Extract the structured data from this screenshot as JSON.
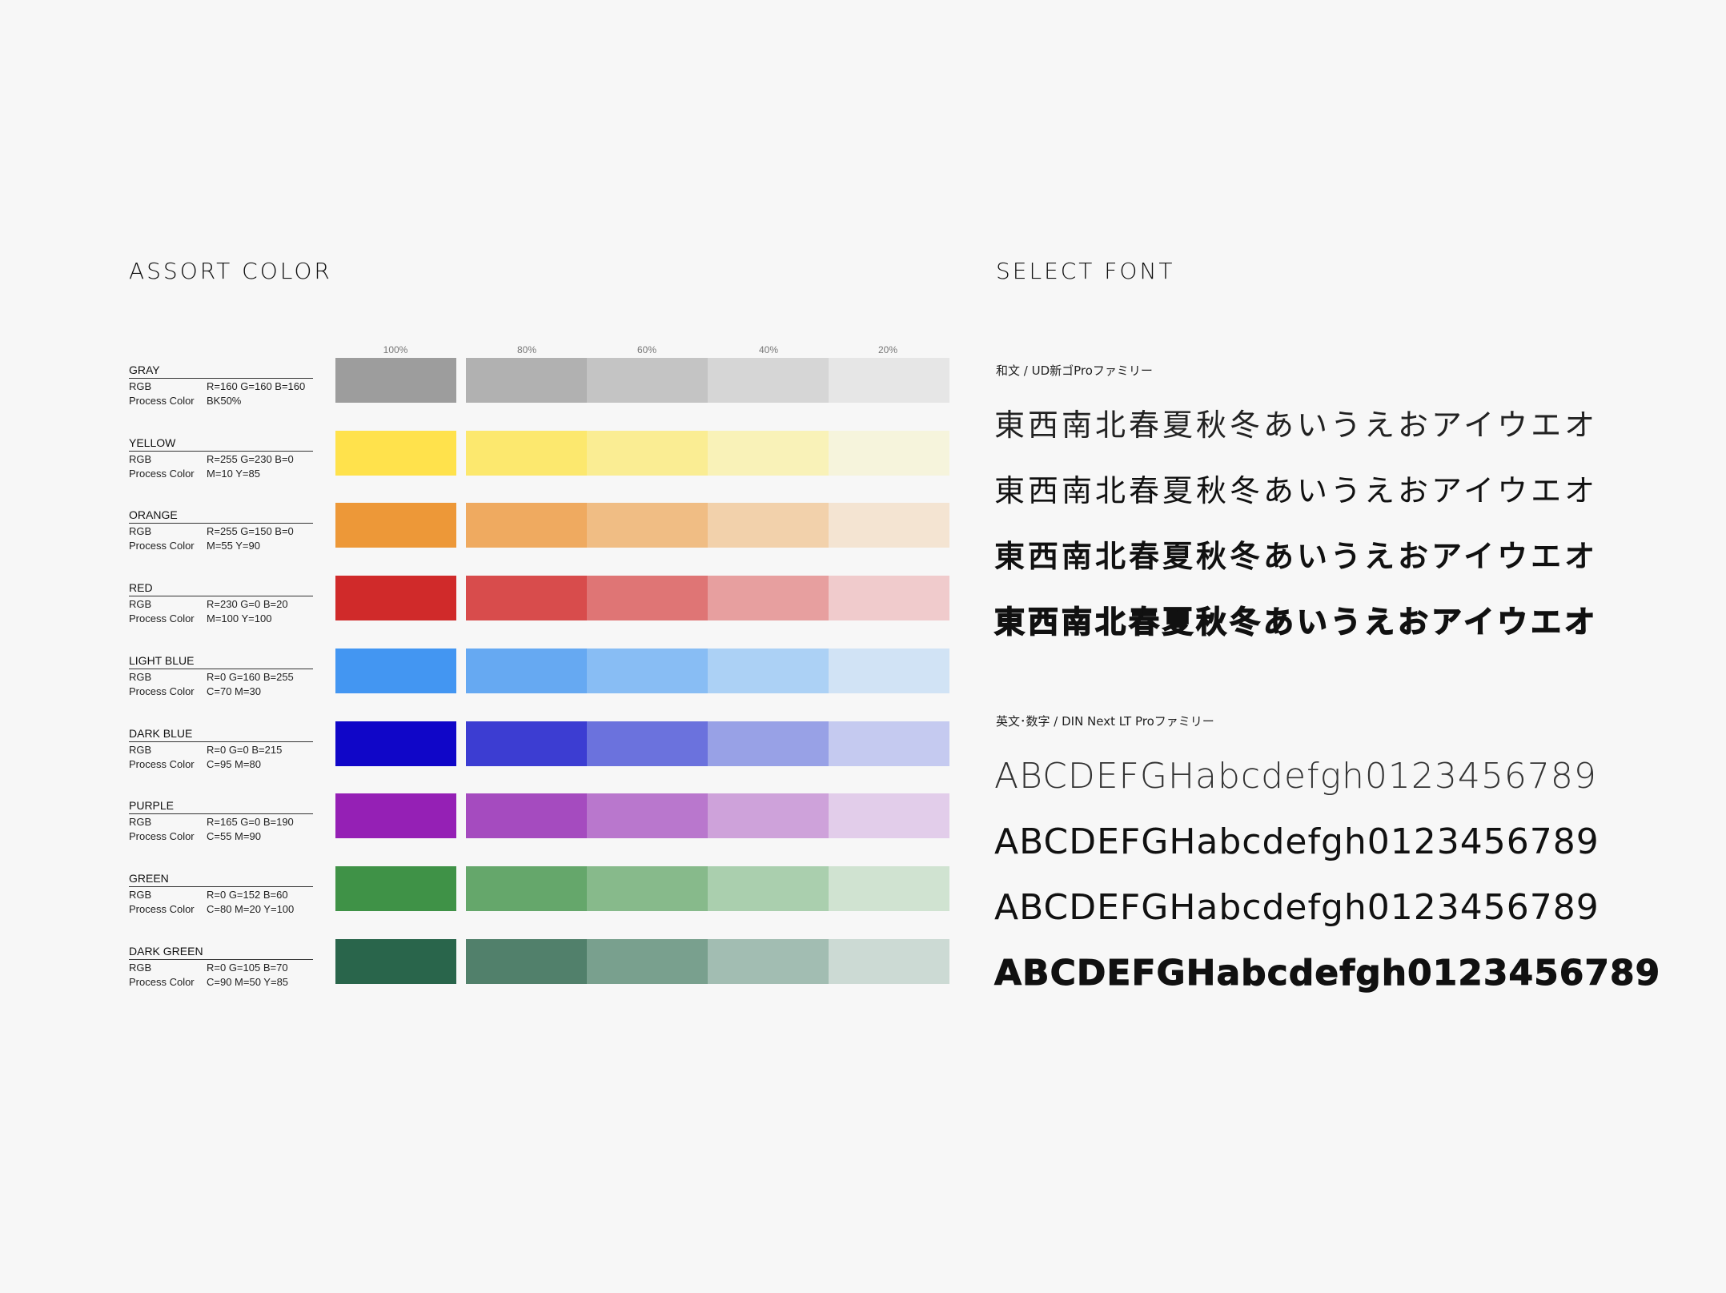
{
  "left": {
    "title": "ASSORT COLOR",
    "percent_labels": [
      "100%",
      "80%",
      "60%",
      "40%",
      "20%"
    ],
    "colors": [
      {
        "name": "GRAY",
        "rgb_label": "RGB",
        "rgb": "R=160 G=160 B=160",
        "process_label": "Process Color",
        "process": "BK50%",
        "swatches": [
          "#9d9d9d",
          "#b1b1b1",
          "#c4c4c4",
          "#d6d6d6",
          "#e6e6e6"
        ]
      },
      {
        "name": "YELLOW",
        "rgb_label": "RGB",
        "rgb": "R=255 G=230 B=0",
        "process_label": "Process Color",
        "process": "M=10 Y=85",
        "swatches": [
          "#ffe24c",
          "#fce86e",
          "#faed93",
          "#f9f2b8",
          "#f6f4dc"
        ]
      },
      {
        "name": "ORANGE",
        "rgb_label": "RGB",
        "rgb": "R=255 G=150 B=0",
        "process_label": "Process Color",
        "process": "M=55 Y=90",
        "swatches": [
          "#ed9838",
          "#efaa60",
          "#f0bd84",
          "#f2d1ab",
          "#f4e4d2"
        ]
      },
      {
        "name": "RED",
        "rgb_label": "RGB",
        "rgb": "R=230 G=0 B=20",
        "process_label": "Process Color",
        "process": "M=100 Y=100",
        "swatches": [
          "#d02a2a",
          "#d84c4c",
          "#df7575",
          "#e79f9f",
          "#f0cbcc"
        ]
      },
      {
        "name": "LIGHT BLUE",
        "rgb_label": "RGB",
        "rgb": "R=0 G=160 B=255",
        "process_label": "Process Color",
        "process": "C=70 M=30",
        "swatches": [
          "#4396f2",
          "#66a9f2",
          "#88bdf4",
          "#acd1f5",
          "#d1e3f5"
        ]
      },
      {
        "name": "DARK BLUE",
        "rgb_label": "RGB",
        "rgb": "R=0 G=0 B=215",
        "process_label": "Process Color",
        "process": "C=95 M=80",
        "swatches": [
          "#1006c8",
          "#3c3dd2",
          "#6b72dd",
          "#98a1e6",
          "#c5caf0"
        ]
      },
      {
        "name": "PURPLE",
        "rgb_label": "RGB",
        "rgb": "R=165 G=0 B=190",
        "process_label": "Process Color",
        "process": "C=55 M=90",
        "swatches": [
          "#9520b5",
          "#a54bbf",
          "#b977cd",
          "#cea2da",
          "#e2cdea"
        ]
      },
      {
        "name": "GREEN",
        "rgb_label": "RGB",
        "rgb": "R=0 G=152 B=60",
        "process_label": "Process Color",
        "process": "C=80 M=20 Y=100",
        "swatches": [
          "#3f9247",
          "#65a76b",
          "#87ba8b",
          "#aacfae",
          "#d0e3d1"
        ]
      },
      {
        "name": "DARK GREEN",
        "rgb_label": "RGB",
        "rgb": "R=0 G=105 B=70",
        "process_label": "Process Color",
        "process": "C=90 M=50 Y=85",
        "swatches": [
          "#29654b",
          "#51806b",
          "#79a08e",
          "#a2bdb2",
          "#ccdad4"
        ]
      }
    ]
  },
  "right": {
    "title": "SELECT FONT",
    "jp_label": "和文 / UD新ゴProファミリー",
    "jp_sample": "東西南北春夏秋冬あいうえおアイウエオ",
    "en_label": "英文･数字 / DIN Next LT Proファミリー",
    "en_sample": "ABCDEFGHabcdefgh0123456789"
  }
}
